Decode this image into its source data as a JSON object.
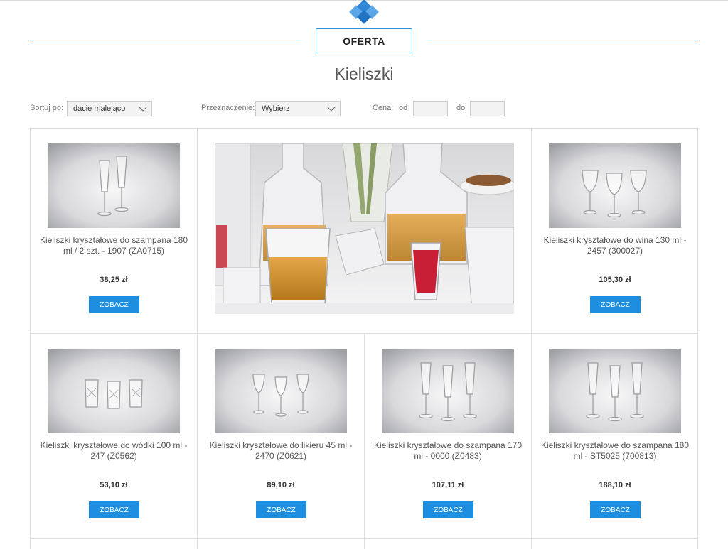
{
  "header": {
    "section_label": "OFERTA",
    "page_title": "Kieliszki"
  },
  "filters": {
    "sort_label": "Sortuj po:",
    "sort_value": "dacie malejąco",
    "purpose_label": "Przeznaczenie:",
    "purpose_value": "Wybierz",
    "price_label": "Cena:",
    "price_from_label": "od",
    "price_to_label": "do",
    "price_from_value": "",
    "price_to_value": ""
  },
  "products": [
    {
      "name": "Kieliszki kryształowe do szampana 180 ml / 2 szt. - 1907 (ZA0715)",
      "price": "38,25 zł",
      "button": "ZOBACZ",
      "shape": "flute2"
    },
    {
      "name": "Kieliszki kryształowe do wina 130 ml - 2457 (300027)",
      "price": "105,30 zł",
      "button": "ZOBACZ",
      "shape": "wine3"
    },
    {
      "name": "Kieliszki kryształowe do wódki 100 ml - 247 (Z0562)",
      "price": "53,10 zł",
      "button": "ZOBACZ",
      "shape": "tumbler3"
    },
    {
      "name": "Kieliszki kryształowe do likieru 45 ml - 2470 (Z0621)",
      "price": "89,10 zł",
      "button": "ZOBACZ",
      "shape": "liqueur3"
    },
    {
      "name": "Kieliszki kryształowe do szampana 170 ml - 0000 (Z0483)",
      "price": "107,11 zł",
      "button": "ZOBACZ",
      "shape": "flute3"
    },
    {
      "name": "Kieliszki kryształowe do szampana 180 ml - ST5025 (700813)",
      "price": "188,10 zł",
      "button": "ZOBACZ",
      "shape": "flute3cut"
    }
  ]
}
